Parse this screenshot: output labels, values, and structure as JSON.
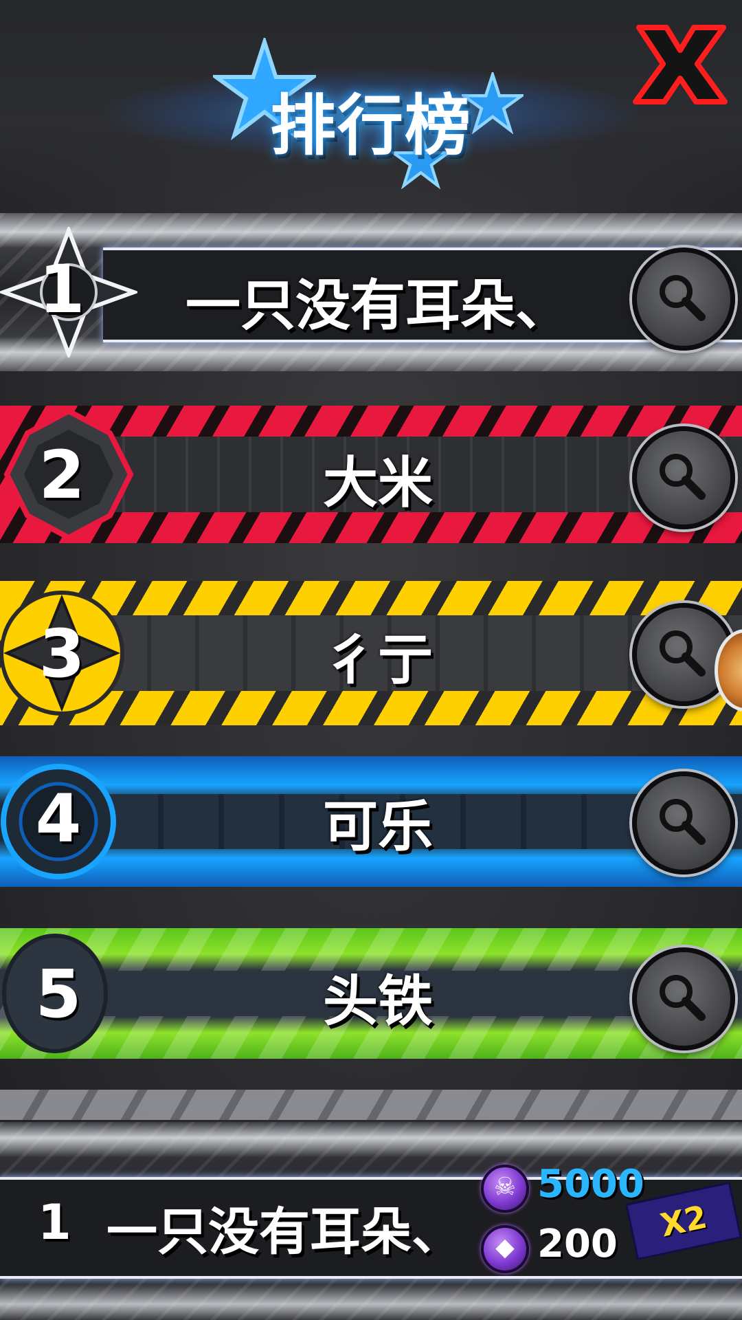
{
  "header": {
    "title": "排行榜",
    "close_icon": "close-x-icon",
    "accent_color": "#2fa9ff",
    "close_color": "#ff1e1e"
  },
  "leaderboard": {
    "rows": [
      {
        "rank": "1",
        "name": "一只没有耳朵、",
        "theme": "silver",
        "action_icon": "magnifier-icon"
      },
      {
        "rank": "2",
        "name": "大米",
        "theme": "red",
        "action_icon": "magnifier-icon"
      },
      {
        "rank": "3",
        "name": "彳亍",
        "theme": "yellow",
        "action_icon": "magnifier-icon"
      },
      {
        "rank": "4",
        "name": "可乐",
        "theme": "blue",
        "action_icon": "magnifier-icon"
      },
      {
        "rank": "5",
        "name": "头铁",
        "theme": "green",
        "action_icon": "magnifier-icon"
      }
    ]
  },
  "my_entry": {
    "rank": "1",
    "name": "一只没有耳朵、",
    "currency_primary": {
      "value": "5000",
      "icon": "skull-coin-icon",
      "color": "#29b6ff"
    },
    "currency_secondary": {
      "value": "200",
      "icon": "gem-coin-icon",
      "color": "#ffffff"
    },
    "multiplier": "X2"
  }
}
